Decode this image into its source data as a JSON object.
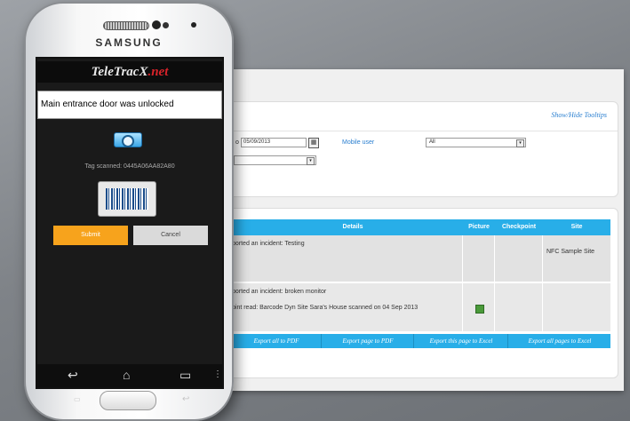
{
  "webpage": {
    "tooltip_link": "Show/Hide Tooltips",
    "date_label": "o",
    "date_value": "05/09/2013",
    "calendar_icon": "calendar-icon",
    "mobile_user_label": "Mobile user",
    "mobile_user_value": "All",
    "second_select_value": "",
    "table": {
      "headers": [
        "Details",
        "Picture",
        "Checkpoint",
        "Site"
      ],
      "rows": [
        {
          "details": [
            "ported an incident: Testing"
          ],
          "picture": "",
          "checkpoint": "",
          "site": "NFC Sample Site"
        },
        {
          "details": [
            "ported an incident: broken monitor",
            "oint read: Barcode Dyn Site Sara's House scanned on 04 Sep 2013"
          ],
          "picture": "image-icon",
          "checkpoint": "",
          "site": ""
        }
      ]
    },
    "export_buttons": [
      "Export all to PDF",
      "Export page to PDF",
      "Export this page to Excel",
      "Export all pages to Excel"
    ]
  },
  "phone": {
    "brand": "SAMSUNG",
    "app_logo": {
      "prefix": "TeleTracX",
      "suffix": ".net"
    },
    "message": "Main entrance door was unlocked",
    "camera_icon": "camera-icon",
    "tag_scanned": "Tag scanned: 0445A06AA82A80",
    "barcode_icon": "barcode-icon",
    "submit_label": "Submit",
    "cancel_label": "Cancel",
    "nav": {
      "back": "↩",
      "home": "⌂",
      "recent": "▭",
      "menu": "⋮"
    }
  },
  "colors": {
    "accent_blue": "#28aee8",
    "submit_orange": "#f7a31c",
    "logo_red": "#d8232a"
  }
}
